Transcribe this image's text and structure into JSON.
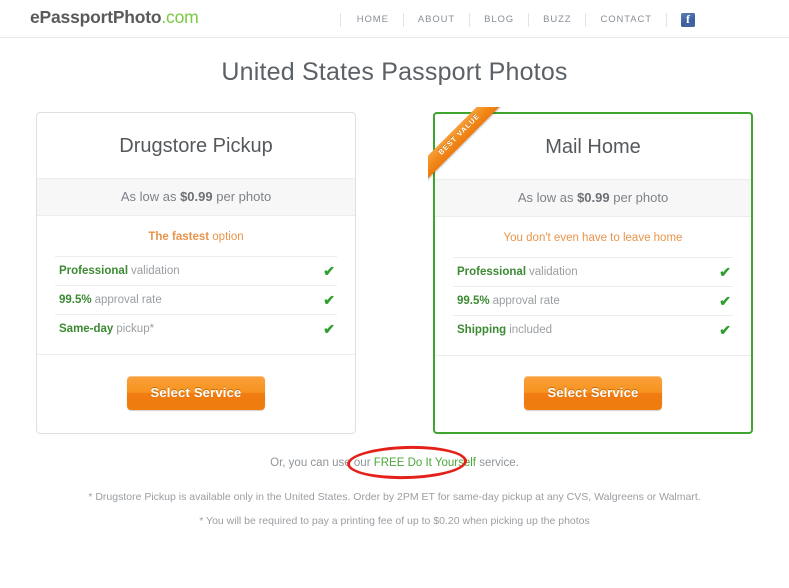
{
  "header": {
    "logo_main": "ePassportPhoto",
    "logo_suffix": ".com",
    "nav": [
      {
        "label": "HOME"
      },
      {
        "label": "ABOUT"
      },
      {
        "label": "BLOG"
      },
      {
        "label": "BUZZ"
      },
      {
        "label": "CONTACT"
      }
    ],
    "facebook_icon": "facebook-icon"
  },
  "page_title": "United States Passport Photos",
  "cards": [
    {
      "id": "drugstore-pickup",
      "title": "Drugstore Pickup",
      "price_prefix": "As low as ",
      "price_value": "$0.99",
      "price_suffix": " per photo",
      "tagline_strong": "The fastest",
      "tagline_rest": " option",
      "features": [
        {
          "strong": "Professional",
          "rest": "validation",
          "check": "✔"
        },
        {
          "strong": "99.5%",
          "rest": "approval rate",
          "check": "✔"
        },
        {
          "strong": "Same-day",
          "rest": "pickup*",
          "check": "✔"
        }
      ],
      "button_label": "Select Service",
      "featured": false,
      "ribbon": null
    },
    {
      "id": "mail-home",
      "title": "Mail Home",
      "price_prefix": "As low as ",
      "price_value": "$0.99",
      "price_suffix": " per photo",
      "tagline_strong": "",
      "tagline_rest": "You don't even have to leave home",
      "features": [
        {
          "strong": "Professional",
          "rest": "validation",
          "check": "✔"
        },
        {
          "strong": "99.5%",
          "rest": "approval rate",
          "check": "✔"
        },
        {
          "strong": "Shipping",
          "rest": "included",
          "check": "✔"
        }
      ],
      "button_label": "Select Service",
      "featured": true,
      "ribbon": "BEST VALUE"
    }
  ],
  "diy": {
    "prefix": "Or, you can use our ",
    "link": "FREE Do It Yourself",
    "suffix": " service."
  },
  "footnotes": [
    "* Drugstore Pickup is available only in the United States. Order by 2PM ET for same-day pickup at any CVS, Walgreens or Walmart.",
    "* You will be required to pay a printing fee of up to $0.20 when picking up the photos"
  ],
  "colors": {
    "brand_green": "#7ac943",
    "accent_orange": "#f7931e",
    "featured_border": "#3fa52f",
    "annotation_red": "#e32119",
    "link_green": "#4aa83a"
  }
}
